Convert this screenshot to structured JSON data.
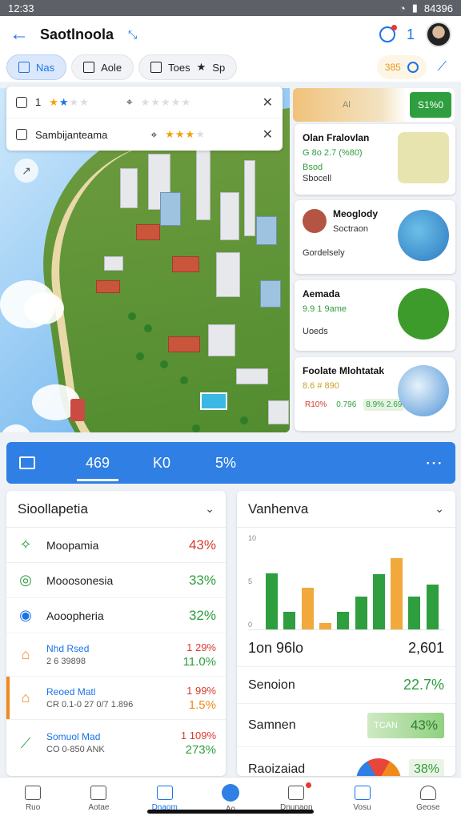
{
  "status": {
    "time": "12:33",
    "right": "84396"
  },
  "appbar": {
    "title": "Saotlnoola",
    "expand_icon": "expand-icon",
    "count": "1"
  },
  "toolbar": {
    "chips": [
      "Nas",
      "Aole",
      "Toes"
    ],
    "extra": "Sp",
    "rating": "385"
  },
  "layers": [
    {
      "label": "1",
      "stars_filled": 2
    },
    {
      "label": "Sambijanteama",
      "stars_filled": 3
    }
  ],
  "side_header": {
    "text": "Al",
    "button": "S1%0"
  },
  "cards": [
    {
      "title": "Olan Fralovlan",
      "meta": "G 8o 2.7 (%80)",
      "sub1": "Bsod",
      "sub2": "Sbocell"
    },
    {
      "title": "Meoglody",
      "meta": "Soctraon",
      "sub1": "Gordelsely"
    },
    {
      "title": "Aemada",
      "meta": "9.9 1 9ame",
      "sub1": "Uoeds"
    },
    {
      "title": "Foolate Mlohtatak",
      "meta": "8.6 # 890",
      "stats": [
        "R10%",
        "0.796",
        "8.9% 2.69"
      ]
    }
  ],
  "tabbar": {
    "tabs": [
      "469",
      "K0",
      "5%"
    ]
  },
  "left_panel": {
    "title": "Sioollapetia",
    "rows": [
      {
        "label": "Moopamia",
        "value": "43%",
        "color": "#d83b2e"
      },
      {
        "label": "Mooosonesia",
        "value": "33%",
        "color": "#2e9e3f"
      },
      {
        "label": "Aooopheria",
        "value": "32%",
        "color": "#2e9e3f"
      },
      {
        "label": "Nhd Rsed",
        "label2": "2 6 39898",
        "v1": "1 29%",
        "v2": "11.0%"
      },
      {
        "label": "Reoed Matl",
        "label2": "CR 0.1-0 27 0/7 1.896",
        "v1": "1 99%",
        "v2": "1.5%"
      },
      {
        "label": "Somuol Mad",
        "label2": "CO 0-850 ANK",
        "v1": "1 109%",
        "v2": "273%"
      }
    ]
  },
  "right_panel": {
    "title": "Vanhenva",
    "rows": [
      {
        "label": "1on 96lo",
        "value": "2,601"
      },
      {
        "label": "Senoion",
        "value": "22.7%"
      },
      {
        "label": "Samnen",
        "value": "43%",
        "pill_note": "TCAN"
      },
      {
        "label": "Raoizaiad",
        "value": "38%"
      }
    ]
  },
  "chart_data": {
    "type": "bar",
    "ylabels": [
      "10",
      "5",
      "0"
    ],
    "values": [
      65,
      20,
      48,
      7,
      20,
      38,
      64,
      82,
      38,
      52
    ],
    "colors": [
      "#2e9e3f",
      "#2e9e3f",
      "#f2a93b",
      "#f2a93b",
      "#2e9e3f",
      "#2e9e3f",
      "#2e9e3f",
      "#f2a93b",
      "#2e9e3f",
      "#2e9e3f"
    ]
  },
  "bottomnav": [
    "Ruo",
    "Aotae",
    "Dnaom",
    "Ao",
    "Dnunaon",
    "Vosu",
    "Geose"
  ]
}
